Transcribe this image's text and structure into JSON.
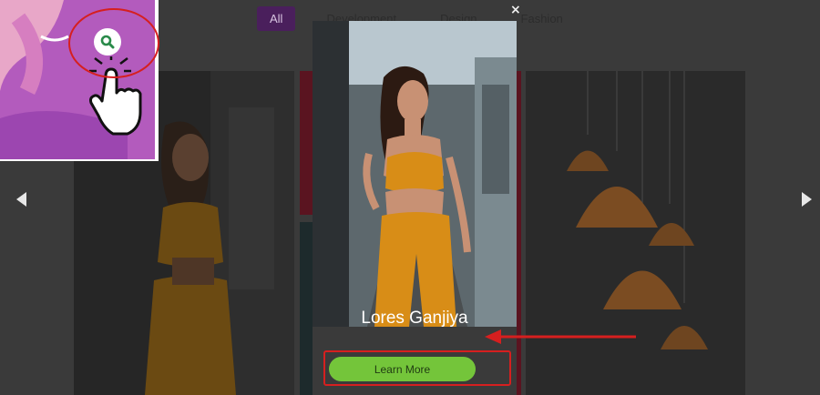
{
  "filters": [
    {
      "label": "All",
      "active": true
    },
    {
      "label": "Development",
      "active": false
    },
    {
      "label": "Design",
      "active": false
    },
    {
      "label": "Fashion",
      "active": false
    }
  ],
  "modal": {
    "title": "Lores Ganjiya",
    "button_label": "Learn More",
    "close_glyph": "×"
  },
  "colors": {
    "overlay_bg": "#3a3a3a",
    "active_filter": "#4a1f5c",
    "learn_more_button": "#74c53a",
    "annotation_red": "#d61f1f"
  },
  "icons": {
    "zoom": "search-icon",
    "hand": "pointing-hand-icon",
    "prev": "chevron-left-icon",
    "next": "chevron-right-icon"
  }
}
